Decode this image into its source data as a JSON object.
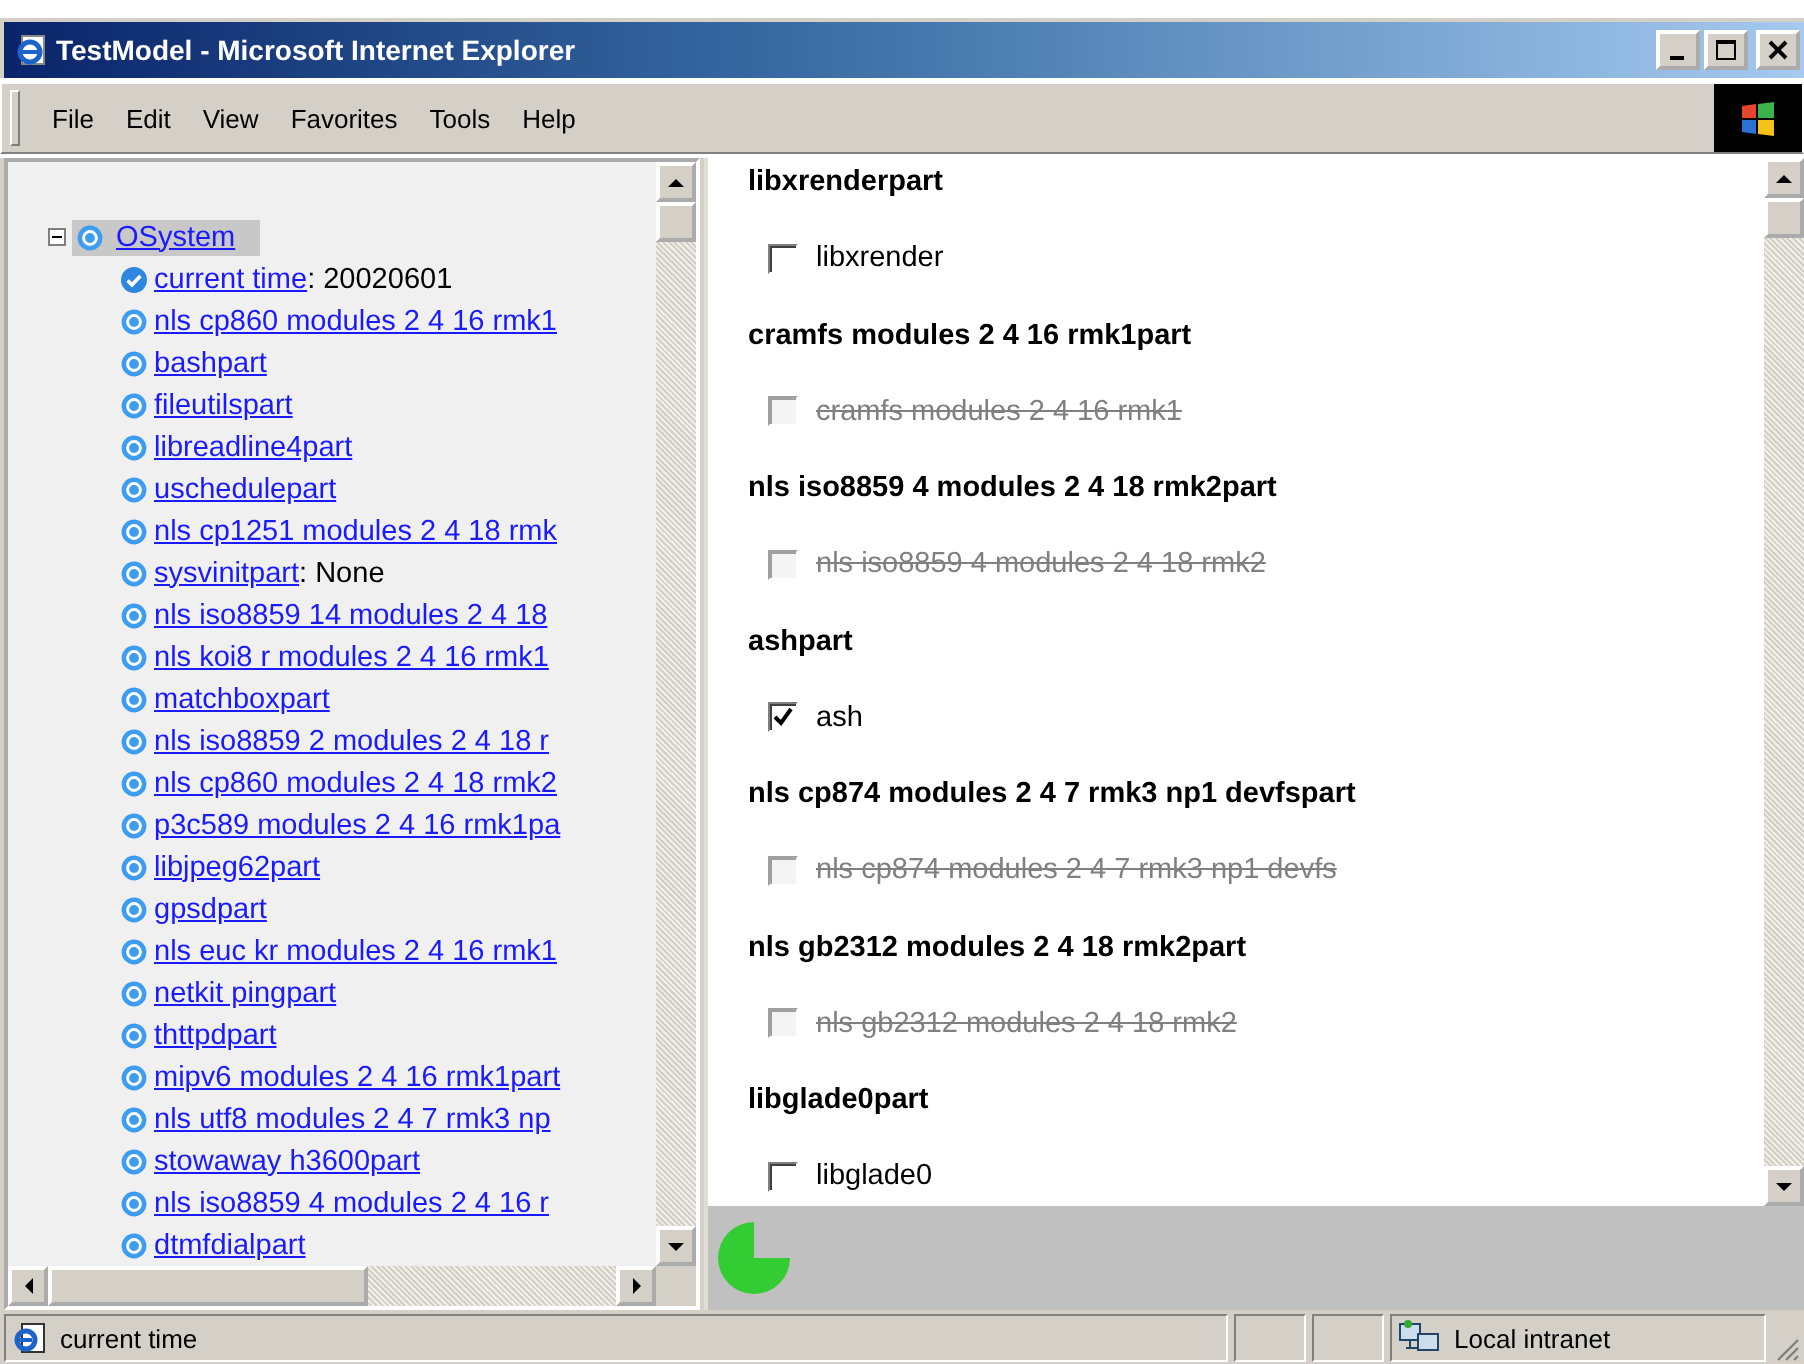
{
  "window": {
    "title": "TestModel - Microsoft Internet Explorer"
  },
  "menu": [
    "File",
    "Edit",
    "View",
    "Favorites",
    "Tools",
    "Help"
  ],
  "tree": {
    "label": "OSystem",
    "expanded": true,
    "selected": true,
    "children": [
      {
        "label": "current time",
        "value": ": 20020601",
        "kind": "attribute"
      },
      {
        "label": "nls cp860 modules 2 4 16 rmk1",
        "kind": "part"
      },
      {
        "label": "bashpart",
        "kind": "part"
      },
      {
        "label": "fileutilspart",
        "kind": "part"
      },
      {
        "label": "libreadline4part",
        "kind": "part"
      },
      {
        "label": "uschedulepart",
        "kind": "part"
      },
      {
        "label": "nls cp1251 modules 2 4 18 rmk",
        "kind": "part"
      },
      {
        "label": "sysvinitpart",
        "value": ": None",
        "kind": "part"
      },
      {
        "label": "nls iso8859 14 modules 2 4 18",
        "kind": "part"
      },
      {
        "label": "nls koi8 r modules 2 4 16 rmk1",
        "kind": "part"
      },
      {
        "label": "matchboxpart",
        "kind": "part"
      },
      {
        "label": "nls iso8859 2 modules 2 4 18 r",
        "kind": "part"
      },
      {
        "label": "nls cp860 modules 2 4 18 rmk2",
        "kind": "part"
      },
      {
        "label": "p3c589 modules 2 4 16 rmk1pa",
        "kind": "part"
      },
      {
        "label": "libjpeg62part",
        "kind": "part"
      },
      {
        "label": "gpsdpart",
        "kind": "part"
      },
      {
        "label": "nls euc kr modules 2 4 16 rmk1",
        "kind": "part"
      },
      {
        "label": "netkit pingpart",
        "kind": "part"
      },
      {
        "label": "thttpdpart",
        "kind": "part"
      },
      {
        "label": "mipv6 modules 2 4 16 rmk1part",
        "kind": "part"
      },
      {
        "label": "nls utf8 modules 2 4 7 rmk3 np",
        "kind": "part"
      },
      {
        "label": "stowaway h3600part",
        "kind": "part"
      },
      {
        "label": "nls iso8859 4 modules 2 4 16 r",
        "kind": "part"
      },
      {
        "label": "dtmfdialpart",
        "kind": "part"
      }
    ]
  },
  "sections": [
    {
      "heading": "libxrenderpart",
      "option": {
        "label": "libxrender",
        "checked": false,
        "disabled": false
      }
    },
    {
      "heading": "cramfs modules 2 4 16 rmk1part",
      "option": {
        "label": "cramfs modules 2 4 16 rmk1",
        "checked": false,
        "disabled": true
      }
    },
    {
      "heading": "nls iso8859 4 modules 2 4 18 rmk2part",
      "option": {
        "label": "nls iso8859 4 modules 2 4 18 rmk2",
        "checked": false,
        "disabled": true
      }
    },
    {
      "heading": "ashpart",
      "option": {
        "label": "ash",
        "checked": true,
        "disabled": false
      }
    },
    {
      "heading": "nls cp874 modules 2 4 7 rmk3 np1 devfspart",
      "option": {
        "label": "nls cp874 modules 2 4 7 rmk3 np1 devfs",
        "checked": false,
        "disabled": true
      }
    },
    {
      "heading": "nls gb2312 modules 2 4 18 rmk2part",
      "option": {
        "label": "nls gb2312 modules 2 4 18 rmk2",
        "checked": false,
        "disabled": true
      }
    },
    {
      "heading": "libglade0part",
      "option": {
        "label": "libglade0",
        "checked": false,
        "disabled": false
      }
    }
  ],
  "status_bar": {
    "text": "current time",
    "zone": "Local intranet"
  }
}
